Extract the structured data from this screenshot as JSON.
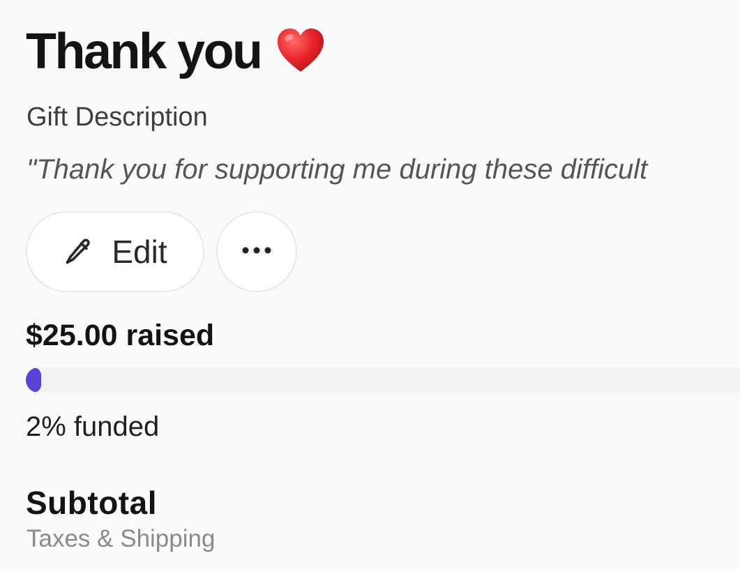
{
  "gift": {
    "title": "Thank you",
    "title_emoji": "heart-icon",
    "description_label": "Gift Description",
    "description_text": "\"Thank you for supporting me during these difficult"
  },
  "actions": {
    "edit_label": "Edit",
    "edit_icon": "pencil-icon",
    "more_icon": "more-horizontal-icon"
  },
  "funding": {
    "raised_text": "$25.00 raised",
    "funded_text": "2% funded",
    "funded_fraction": 0.02,
    "accent_color": "#5a42d6"
  },
  "summary": {
    "subtotal_label": "Subtotal",
    "taxes_label": "Taxes & Shipping"
  }
}
